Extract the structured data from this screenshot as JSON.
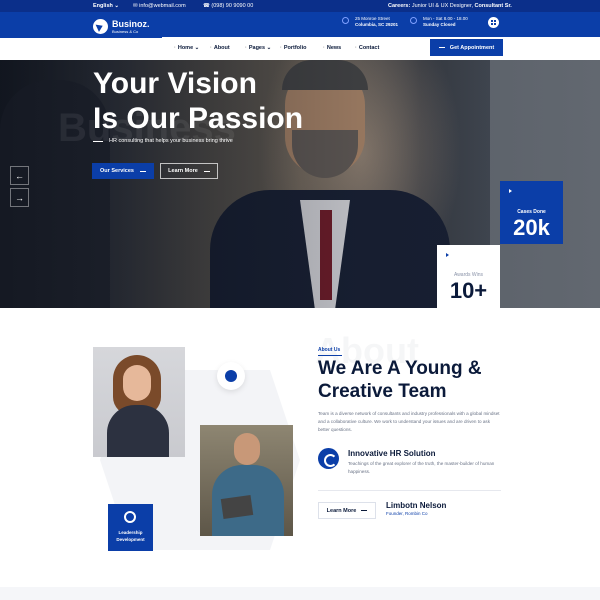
{
  "topbar": {
    "language": "English ⌄",
    "email": "info@webmail.com",
    "phone": "(098) 90 9090 00",
    "career_prefix": "Careers:",
    "career_text": "Junior UI & UX Designer,",
    "career_bold": "Consultant Sr."
  },
  "header": {
    "logo_name": "Businoz.",
    "logo_sub": "Business & Co",
    "address_line1": "25 Monroe Street",
    "address_line2": "Columbia, SC 29201",
    "hours_line1": "Mon - Sat 8.00 - 18.00",
    "hours_line2": "Sunday Closed"
  },
  "nav": {
    "items": [
      "Home ⌄",
      "About",
      "Pages ⌄",
      "Portfolio",
      "News",
      "Contact"
    ],
    "cta": "Get Appointment"
  },
  "hero": {
    "ghost_text": "Business",
    "title_line1": "Your Vision",
    "title_line2": "Is Our Passion",
    "subtitle": "HR consulting that helps your business bring thrive",
    "btn_primary": "Our Services",
    "btn_secondary": "Learn More",
    "prev_arrow": "←",
    "next_arrow": "→",
    "cases_label": "Cases Done",
    "cases_value": "20k",
    "awards_label": "Awards Wins",
    "awards_value": "10+"
  },
  "about": {
    "ghost_text": "About",
    "tag": "About Us",
    "title_line1": "We Are A Young &",
    "title_line2": "Creative Team",
    "description": "Team is a diverse network of consultants and industry professionals with a global mindset and a collaborative culture. We work to understand your issues and are driven to ask better questions.",
    "feature_title": "Innovative HR Solution",
    "feature_desc": "Teachings of the great explorer of the truth, the master-builder of human happiness.",
    "learn_more": "Learn More",
    "person_name": "Limbotn Nelson",
    "person_role": "Founder, Rombin Co",
    "badge_line1": "Leadership",
    "badge_line2": "Development"
  },
  "colors": {
    "primary": "#0b3ea8",
    "topbar": "#0b2f8a",
    "heading": "#0b1a3a"
  }
}
